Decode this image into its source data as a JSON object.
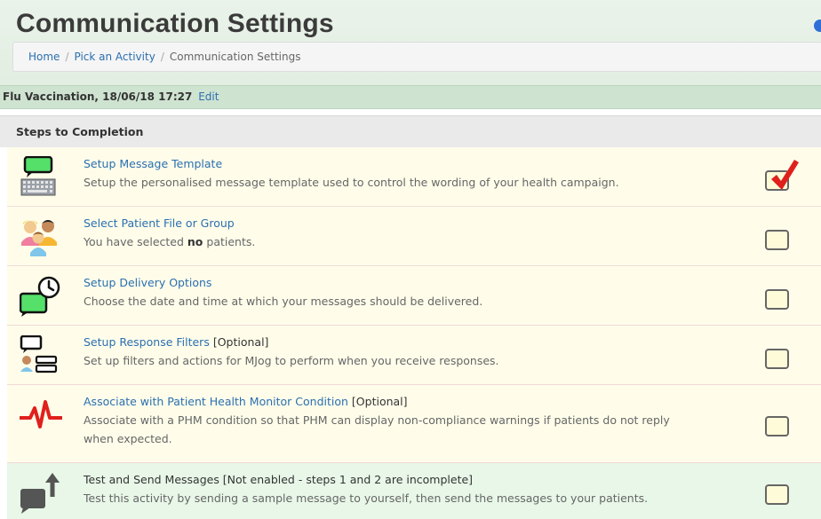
{
  "page": {
    "title": "Communication Settings"
  },
  "breadcrumb": {
    "home": "Home",
    "separator": "/",
    "pick": "Pick an Activity",
    "current": "Communication Settings"
  },
  "activity": {
    "label": "Flu Vaccination, 18/06/18 17:27",
    "edit": "Edit"
  },
  "steps_header": "Steps to Completion",
  "steps": [
    {
      "title": "Setup Message Template",
      "suffix": "",
      "desc": "Setup the personalised message template used to control the wording of your health campaign.",
      "desc2": "",
      "icon": "message-template-icon",
      "checked": true
    },
    {
      "title": "Select Patient File or Group",
      "suffix": "",
      "desc_pre": "You have selected ",
      "desc_bold": "no",
      "desc_post": " patients.",
      "icon": "patients-group-icon",
      "checked": false
    },
    {
      "title": "Setup Delivery Options",
      "suffix": "",
      "desc": "Choose the date and time at which your messages should be delivered.",
      "icon": "delivery-clock-icon",
      "checked": false
    },
    {
      "title": "Setup Response Filters",
      "suffix": " [Optional]",
      "desc": "Set up filters and actions for MJog to perform when you receive responses.",
      "icon": "response-filters-icon",
      "checked": false
    },
    {
      "title": "Associate with Patient Health Monitor Condition",
      "suffix": " [Optional]",
      "desc": "Associate with a PHM condition so that PHM can display non-compliance warnings if patients do not reply",
      "desc2": "when expected.",
      "icon": "heartbeat-icon",
      "checked": false
    },
    {
      "title": "Test and Send Messages [Not enabled - steps 1 and 2 are incomplete]",
      "suffix": "",
      "desc": "Test this activity by sending a sample message to yourself, then send the messages to your patients.",
      "icon": "send-message-icon",
      "checked": false
    }
  ],
  "colors": {
    "link": "#2a6fb0",
    "row_bg": "#fffdea",
    "final_row_bg": "#e8f7e8",
    "activity_bar": "#cfe3d1",
    "check_red": "#e0201c",
    "icon_green": "#55e06a"
  }
}
